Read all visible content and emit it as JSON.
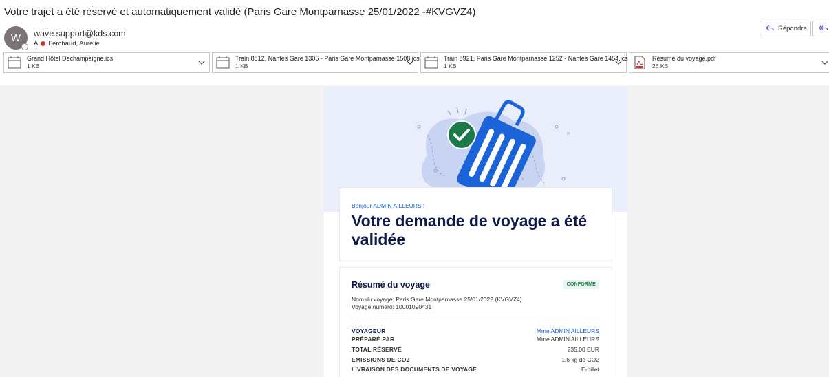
{
  "subject": "Votre trajet a été réservé et automatiquement validé (Paris Gare Montparnasse 25/01/2022 -#KVGVZ4)",
  "sender": {
    "initial": "W",
    "email": "wave.support@kds.com",
    "to_label": "À",
    "recipient": "Ferchaud, Aurélie"
  },
  "actions": {
    "reply_label": "Répondre"
  },
  "attachments": [
    {
      "name": "Grand Hôtel Dechampaigne.ics",
      "size": "1 KB",
      "icon": "calendar-icon"
    },
    {
      "name": "Train 8812, Nantes Gare 1305 - Paris Gare Montparnasse 1508.ics",
      "size": "1 KB",
      "icon": "calendar-icon"
    },
    {
      "name": "Train 8921, Paris Gare Montparnasse 1252 - Nantes Gare 1454.ics",
      "size": "1 KB",
      "icon": "calendar-icon"
    },
    {
      "name": "Résumé du voyage.pdf",
      "size": "26 KB",
      "icon": "pdf-icon"
    }
  ],
  "mail": {
    "greeting": "Bonjour ADMIN AILLEURS !",
    "title": "Votre demande de voyage a été validée",
    "summary": {
      "title": "Résumé du voyage",
      "badge": "CONFORME",
      "trip_name": "Nom du voyage: Paris Gare Montparnasse 25/01/2022 (KVGVZ4)",
      "trip_number": "Voyage numéro: 10001090431",
      "rows": [
        {
          "label": "VOYAGEUR",
          "value": "Mme ADMIN AILLEURS"
        },
        {
          "label": "PRÉPARÉ PAR",
          "value": "Mme ADMIN AILLEURS"
        },
        {
          "label": "TOTAL RÉSERVÉ",
          "value": "235,00 EUR"
        },
        {
          "label": "EMISSIONS DE CO2",
          "value": "1.6 kg de CO2"
        },
        {
          "label": "LIVRAISON DES DOCUMENTS DE VOYAGE",
          "value": "E-billet"
        }
      ]
    }
  },
  "colors": {
    "accent_blue": "#1a5fd6",
    "title_navy": "#0d1a4b",
    "badge_green": "#1a7f4a",
    "hero_bg": "#eaeefb"
  }
}
